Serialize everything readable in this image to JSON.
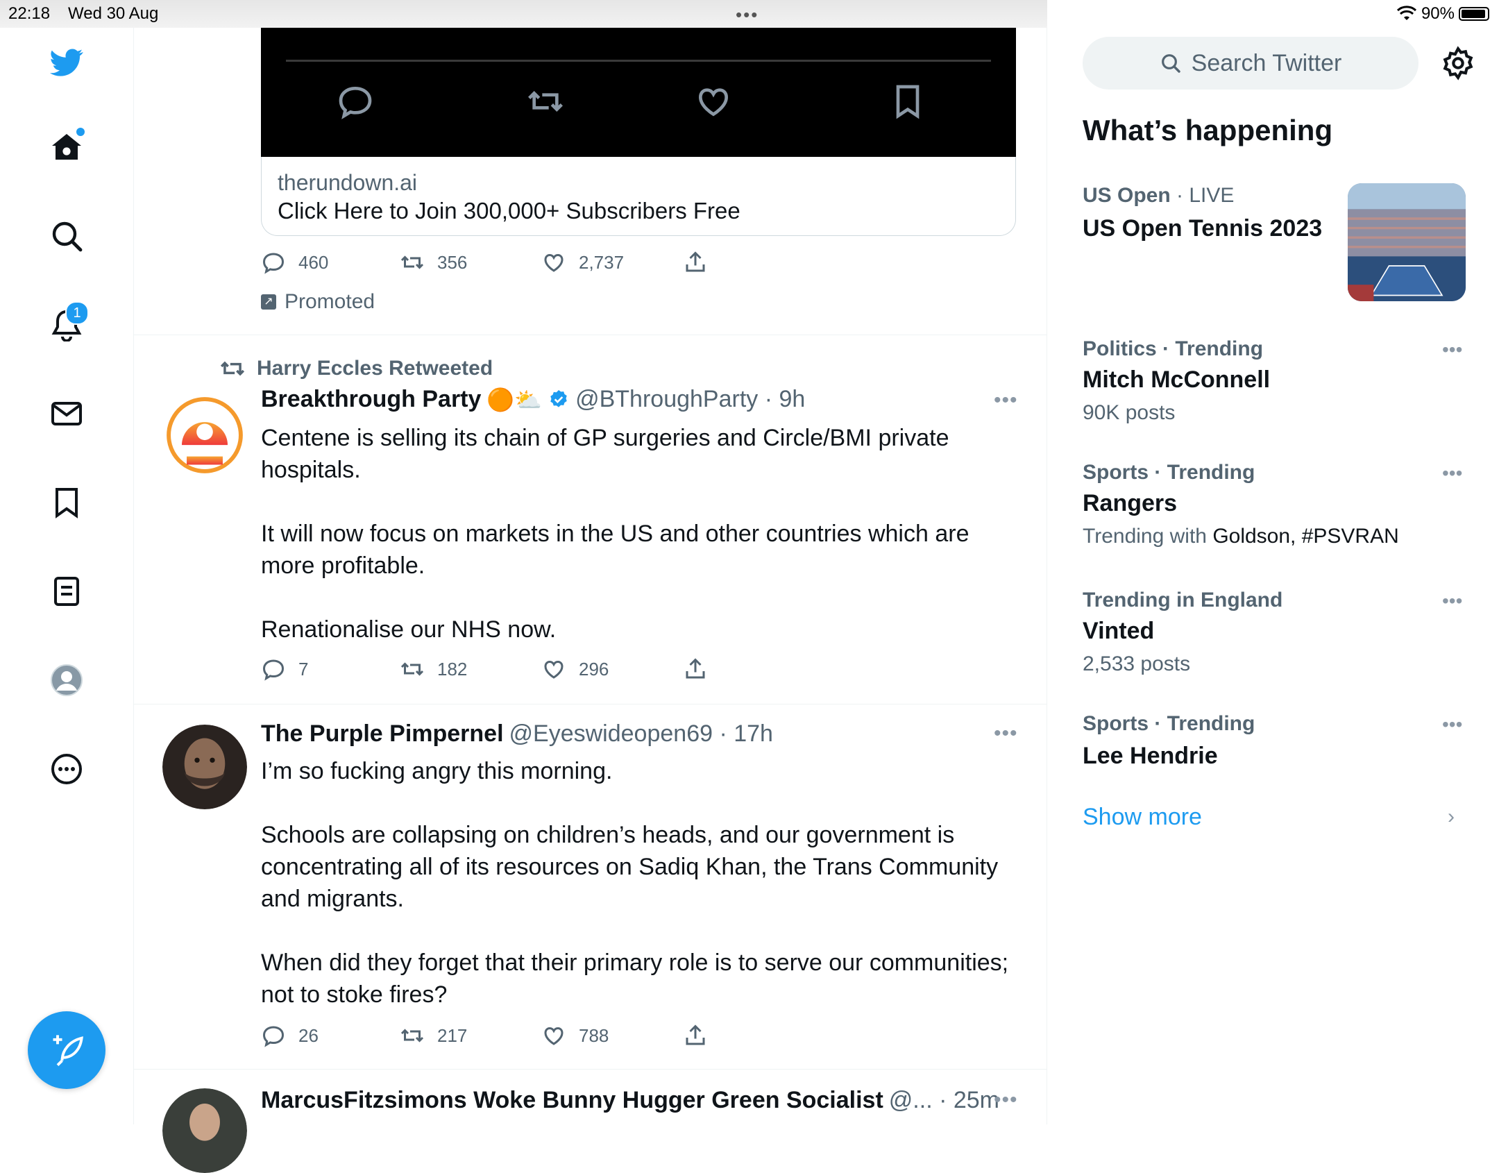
{
  "status_bar": {
    "time": "22:18",
    "date": "Wed 30 Aug",
    "battery": "90%"
  },
  "nav": {
    "notifications_badge": "1",
    "items": [
      "home-icon",
      "explore-icon",
      "notifications-icon",
      "messages-icon",
      "bookmarks-icon",
      "lists-icon",
      "profile-icon",
      "more-icon"
    ]
  },
  "promoted_tweet": {
    "card_domain": "therundown.ai",
    "card_title": "Click Here to Join 300,000+ Subscribers Free",
    "replies": "460",
    "retweets": "356",
    "likes": "2,737",
    "promoted_label": "Promoted"
  },
  "tweets": [
    {
      "retweeted_by": "Harry Eccles Retweeted",
      "name": "Breakthrough Party",
      "name_emojis": "🟠⛅",
      "handle_time": "@BThroughParty · 9h",
      "text": "Centene is selling its chain of GP surgeries and Circle/BMI private hospitals.\n\nIt will now focus on markets in the US and other countries which are more profitable.\n\nRenationalise our NHS now.",
      "replies": "7",
      "retweets": "182",
      "likes": "296"
    },
    {
      "name": "The Purple Pimpernel",
      "handle_time": "@Eyeswideopen69 · 17h",
      "text": "I’m so fucking angry this morning.\n\nSchools are collapsing on children’s heads, and our government is concentrating all of its resources on Sadiq Khan, the Trans Community and migrants.\n\nWhen did they forget that their primary role is to serve our communities; not to stoke fires?",
      "replies": "26",
      "retweets": "217",
      "likes": "788"
    },
    {
      "name": "MarcusFitzsimons Woke Bunny Hugger Green Socialist",
      "handle_time": "@... · 25m"
    }
  ],
  "sidebar": {
    "search_placeholder": "Search Twitter",
    "whats_happening": "What’s happening",
    "trends": [
      {
        "meta_strong": "US Open",
        "meta_rest": " · LIVE",
        "name": "US Open Tennis 2023",
        "sub": ""
      },
      {
        "meta_strong": "Politics · Trending",
        "meta_rest": "",
        "name": "Mitch McConnell",
        "sub": "90K posts"
      },
      {
        "meta_strong": "Sports · Trending",
        "meta_rest": "",
        "name": "Rangers",
        "sub_prefix": "Trending with ",
        "sub_strong": "Goldson, #PSVRAN"
      },
      {
        "meta_strong": "Trending in England",
        "meta_rest": "",
        "name": "Vinted",
        "sub": "2,533 posts"
      },
      {
        "meta_strong": "Sports · Trending",
        "meta_rest": "",
        "name": "Lee Hendrie",
        "sub": ""
      }
    ],
    "show_more": "Show more"
  },
  "colors": {
    "accent": "#1d9bf0",
    "muted": "#536471",
    "text": "#0f1419"
  }
}
